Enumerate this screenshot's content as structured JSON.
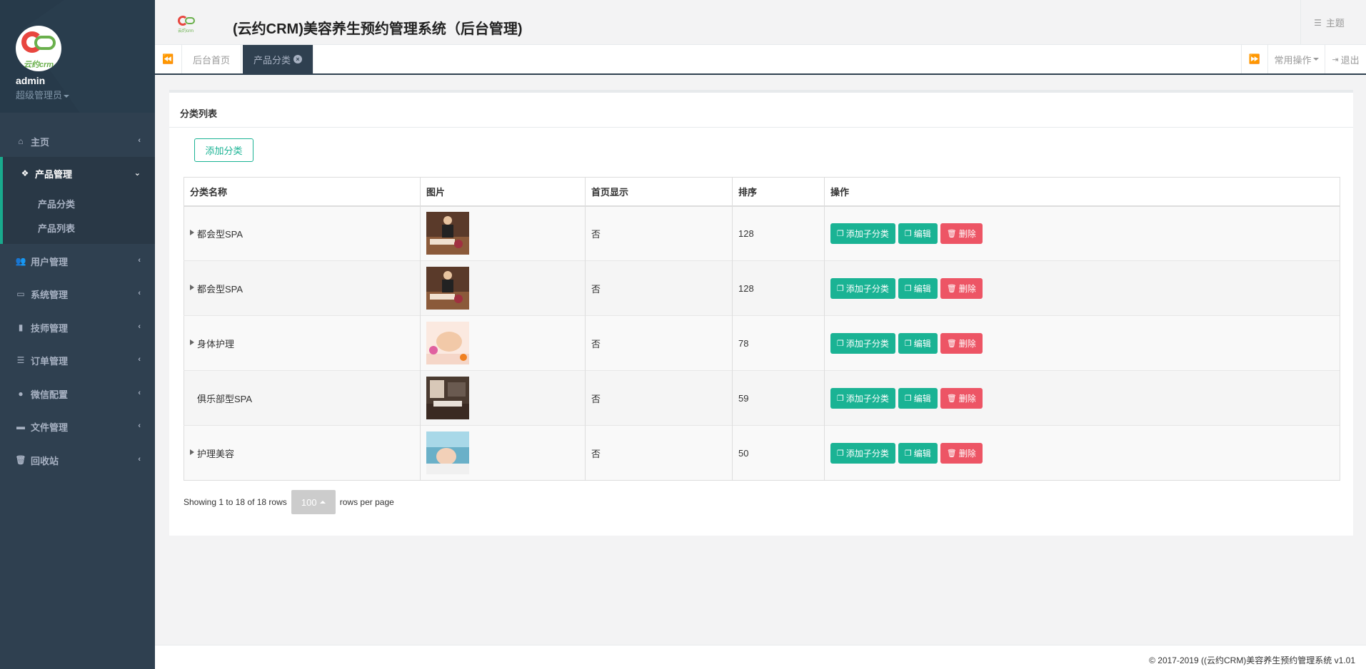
{
  "app": {
    "title": "(云约CRM)美容养生预约管理系统（后台管理)",
    "logo_text": "云约crm",
    "header_logo_text": "云约crm"
  },
  "user": {
    "name": "admin",
    "role": "超级管理员"
  },
  "header": {
    "theme_label": "主题"
  },
  "sidebar": {
    "items": [
      {
        "label": "主页",
        "icon": "home-icon"
      },
      {
        "label": "产品管理",
        "icon": "cubes-icon"
      },
      {
        "label": "用户管理",
        "icon": "users-icon"
      },
      {
        "label": "系统管理",
        "icon": "desktop-icon"
      },
      {
        "label": "技师管理",
        "icon": "book-icon"
      },
      {
        "label": "订单管理",
        "icon": "list-icon"
      },
      {
        "label": "微信配置",
        "icon": "wechat-icon"
      },
      {
        "label": "文件管理",
        "icon": "folder-icon"
      },
      {
        "label": "回收站",
        "icon": "trash-icon"
      }
    ],
    "sub_items": [
      {
        "label": "产品分类"
      },
      {
        "label": "产品列表"
      }
    ]
  },
  "tabs": {
    "items": [
      {
        "label": "后台首页"
      },
      {
        "label": "产品分类"
      }
    ],
    "common_ops_label": "常用操作",
    "logout_label": "退出"
  },
  "panel": {
    "title": "分类列表",
    "add_button": "添加分类"
  },
  "table": {
    "columns": [
      "分类名称",
      "图片",
      "首页显示",
      "排序",
      "操作"
    ],
    "rows": [
      {
        "name": "都会型SPA",
        "has_children": true,
        "show_home": "否",
        "sort": "128",
        "img": "spa-massage"
      },
      {
        "name": "都会型SPA",
        "has_children": true,
        "show_home": "否",
        "sort": "128",
        "img": "spa-massage"
      },
      {
        "name": "身体护理",
        "has_children": true,
        "show_home": "否",
        "sort": "78",
        "img": "face-care"
      },
      {
        "name": "俱乐部型SPA",
        "has_children": false,
        "show_home": "否",
        "sort": "59",
        "img": "spa-room"
      },
      {
        "name": "护理美容",
        "has_children": true,
        "show_home": "否",
        "sort": "50",
        "img": "beauty-care"
      }
    ],
    "actions": {
      "add_child": "添加子分类",
      "edit": "编辑",
      "delete": "删除"
    }
  },
  "pager": {
    "showing": "Showing 1 to 18 of 18 rows",
    "page_size": "100",
    "per_page": "rows per page"
  },
  "footer": {
    "text": "© 2017-2019 ((云约CRM)美容养生预约管理系统 v1.01"
  },
  "colors": {
    "sidebar_bg": "#2f4050",
    "accent": "#1ab394",
    "danger": "#ed5565"
  }
}
